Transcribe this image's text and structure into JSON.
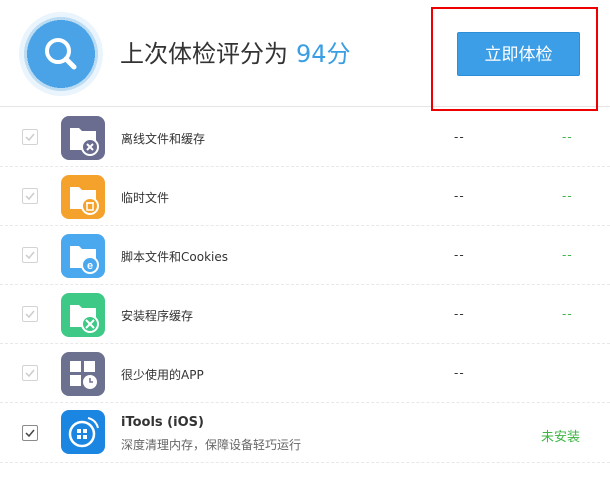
{
  "header": {
    "title": "上次体检评分为",
    "score": "94分",
    "button_label": "立即体检"
  },
  "items": [
    {
      "label": "离线文件和缓存",
      "size": "--",
      "result": "--",
      "icon": "offline-cache-folder-icon",
      "color": "#6a6d8f"
    },
    {
      "label": "临时文件",
      "size": "--",
      "result": "--",
      "icon": "temp-files-folder-icon",
      "color": "#f5a22d"
    },
    {
      "label": "脚本文件和Cookies",
      "size": "--",
      "result": "--",
      "icon": "cookies-folder-icon",
      "color": "#4aa8ef"
    },
    {
      "label": "安装程序缓存",
      "size": "--",
      "result": "--",
      "icon": "installer-cache-folder-icon",
      "color": "#3ec987"
    },
    {
      "label": "很少使用的APP",
      "size": "--",
      "icon": "rarely-used-apps-icon",
      "color": "#6d7190"
    }
  ],
  "itools": {
    "title": "iTools (iOS)",
    "subtitle": "深度清理内存，保障设备轻巧运行",
    "status": "未安装",
    "icon": "itools-icon",
    "color": "#1a86e2"
  }
}
